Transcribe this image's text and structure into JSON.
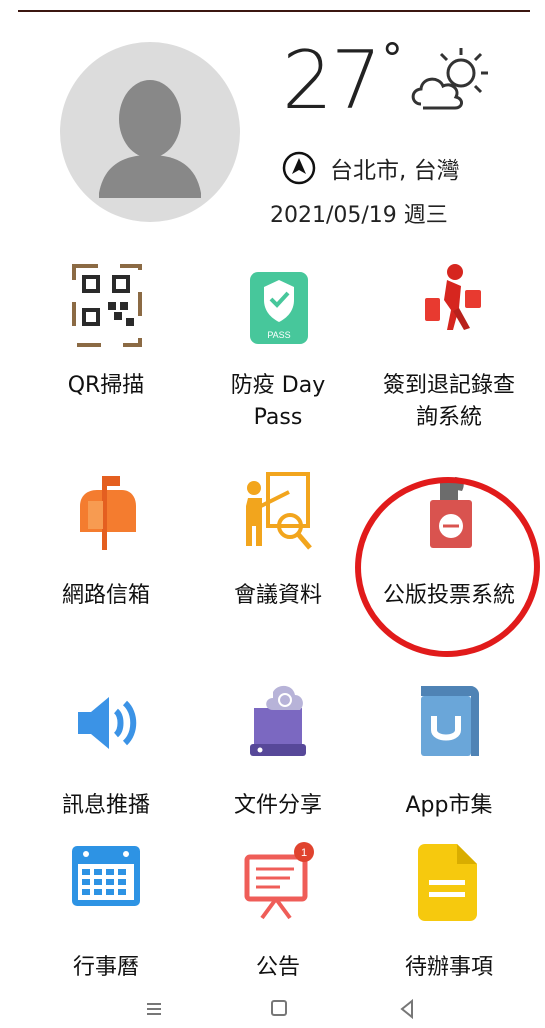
{
  "weather": {
    "temperature": "27",
    "degree_symbol": "°",
    "location": "台北市, 台灣",
    "date": "2021/05/19 週三",
    "condition_icon": "partly-cloudy-icon"
  },
  "apps": [
    {
      "label": "QR掃描",
      "icon": "qr-code-icon"
    },
    {
      "label": "防疫 Day Pass",
      "icon": "pass-shield-icon",
      "icon_text": "PASS"
    },
    {
      "label": "簽到退記錄查詢系統",
      "icon": "walking-person-icon"
    },
    {
      "label": "網路信箱",
      "icon": "mailbox-icon"
    },
    {
      "label": "會議資料",
      "icon": "presentation-icon"
    },
    {
      "label": "公版投票系統",
      "icon": "ballot-box-icon"
    },
    {
      "label": "訊息推播",
      "icon": "speaker-icon"
    },
    {
      "label": "文件分享",
      "icon": "cloud-drive-icon"
    },
    {
      "label": "App市集",
      "icon": "app-store-icon"
    },
    {
      "label": "行事曆",
      "icon": "calendar-icon"
    },
    {
      "label": "公告",
      "icon": "announcement-board-icon",
      "badge": "1"
    },
    {
      "label": "待辦事項",
      "icon": "document-icon"
    }
  ],
  "nav": {
    "buttons": [
      "menu-icon",
      "home-icon",
      "back-icon"
    ]
  },
  "colors": {
    "annotation": "#e11b1b",
    "pass_green": "#47c79b",
    "vote_red": "#d9534f",
    "mail_orange": "#f47c2f",
    "speaker_blue": "#3b93e6",
    "calendar_blue": "#2d93e4",
    "note_yellow": "#f6c90e"
  }
}
